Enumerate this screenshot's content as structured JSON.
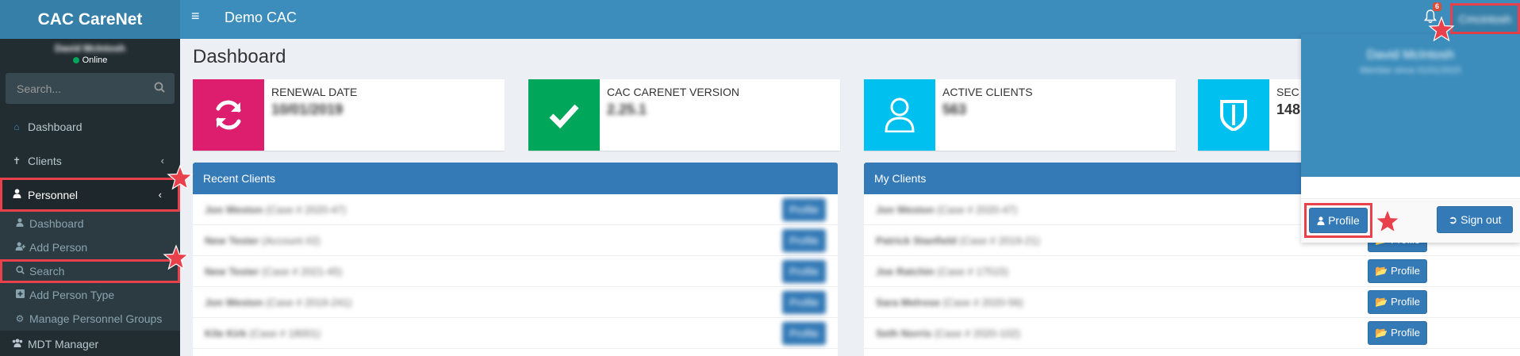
{
  "app": {
    "logo": "CAC CareNet",
    "org": "Demo CAC",
    "user_menu": "Cmcintosh"
  },
  "notifications": {
    "count": "6"
  },
  "sidebar": {
    "user_name": "David McIntosh",
    "user_status": "Online",
    "search_placeholder": "Search...",
    "items": [
      {
        "label": "Dashboard",
        "icon": "home-icon"
      },
      {
        "label": "Clients",
        "icon": "child-icon"
      },
      {
        "label": "Personnel",
        "icon": "user-icon"
      },
      {
        "label": "MDT Manager",
        "icon": "users-icon"
      }
    ],
    "sub_items": [
      {
        "label": "Dashboard",
        "icon": "user-icon"
      },
      {
        "label": "Add Person",
        "icon": "user-plus-icon"
      },
      {
        "label": "Search",
        "icon": "search-icon"
      },
      {
        "label": "Add Person Type",
        "icon": "plus-square-icon"
      },
      {
        "label": "Manage Personnel Groups",
        "icon": "gear-icon"
      }
    ]
  },
  "page": {
    "title": "Dashboard"
  },
  "info_boxes": [
    {
      "label": "RENEWAL DATE",
      "value": "10/01/2019",
      "color": "#dd1e6e",
      "icon": "refresh-icon"
    },
    {
      "label": "CAC CARENET VERSION",
      "value": "2.25.1",
      "color": "#00a65a",
      "icon": "check-icon"
    },
    {
      "label": "ACTIVE CLIENTS",
      "value": "563",
      "color": "#00c0ef",
      "icon": "user-icon"
    },
    {
      "label": "SEC",
      "value": "148",
      "color": "#00c0ef",
      "icon": "shield-icon"
    }
  ],
  "recent_clients": {
    "title": "Recent Clients",
    "button_label": "Profile",
    "rows": [
      {
        "name": "Jon Weston",
        "detail": "(Case # 2020-47)"
      },
      {
        "name": "New Tester",
        "detail": "(Account #2)"
      },
      {
        "name": "New Tester",
        "detail": "(Case # 2021-45)"
      },
      {
        "name": "Jon Weston",
        "detail": "(Case # 2019-241)"
      },
      {
        "name": "Kile Kirk",
        "detail": "(Case # 18001)"
      }
    ]
  },
  "my_clients": {
    "title": "My Clients",
    "button_label": "Profile",
    "rows": [
      {
        "name": "Jon Weston",
        "detail": "(Case # 2020-47)"
      },
      {
        "name": "Patrick Stanfield",
        "detail": "(Case # 2019-21)"
      },
      {
        "name": "Joe Ratchin",
        "detail": "(Case # 17515)"
      },
      {
        "name": "Sara Melrose",
        "detail": "(Case # 2020-56)"
      },
      {
        "name": "Seth Norris",
        "detail": "(Case # 2020-102)"
      }
    ]
  },
  "dropdown": {
    "name": "David McIntosh",
    "member_since": "Member since 01/01/2015",
    "profile_label": "Profile",
    "signout_label": "Sign out"
  }
}
